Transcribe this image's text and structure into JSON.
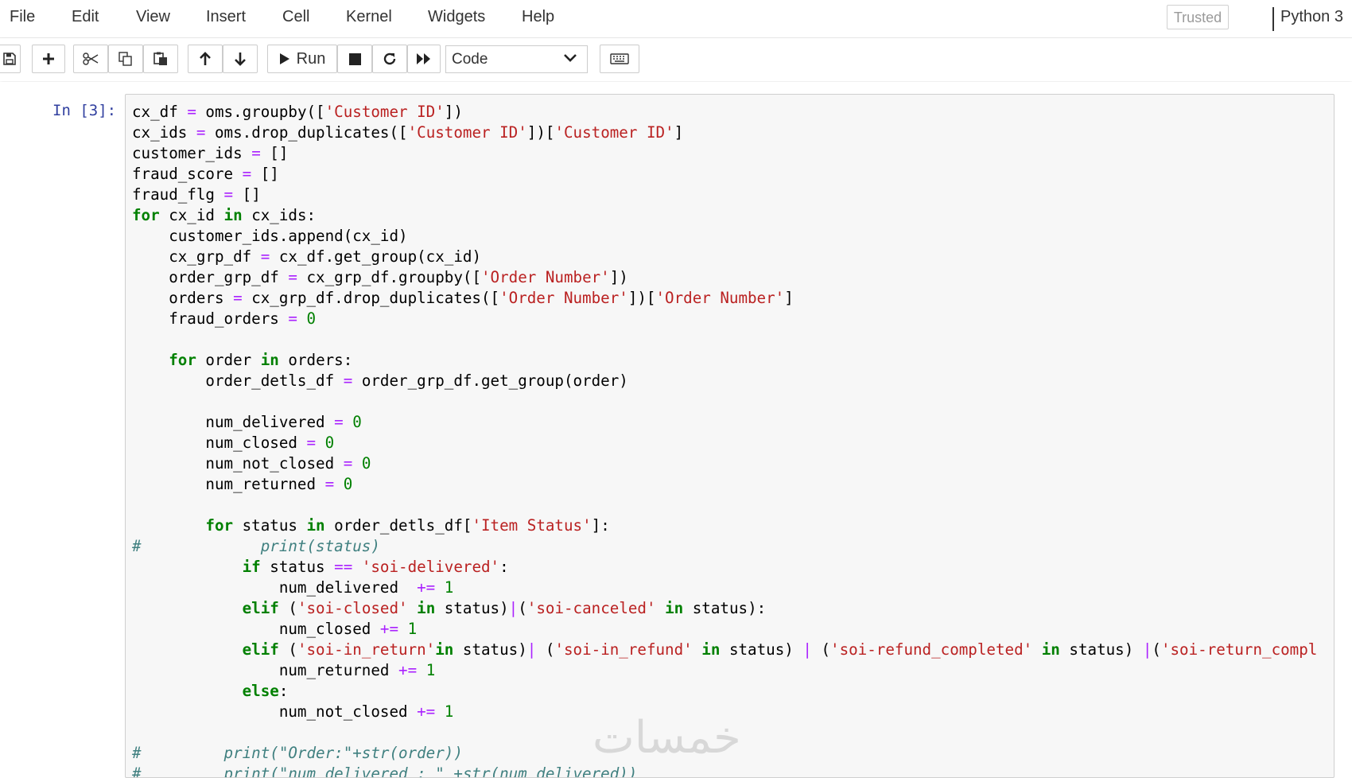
{
  "menu": {
    "items": [
      "File",
      "Edit",
      "View",
      "Insert",
      "Cell",
      "Kernel",
      "Widgets",
      "Help"
    ],
    "trusted_label": "Trusted",
    "kernel_name": "Python 3"
  },
  "toolbar": {
    "run_label": "Run",
    "cell_type": "Code",
    "buttons": [
      "save-icon",
      "plus-icon",
      "scissors-icon",
      "copy-icon",
      "paste-icon",
      "arrow-up-icon",
      "arrow-down-icon",
      "play-icon",
      "stop-icon",
      "restart-icon",
      "fast-forward-icon",
      "keyboard-icon"
    ]
  },
  "cell": {
    "prompt": "In [3]:",
    "lines": [
      [
        [
          "t",
          "cx_df "
        ],
        [
          "o",
          "="
        ],
        [
          "t",
          " oms.groupby(["
        ],
        [
          "s",
          "'Customer ID'"
        ],
        [
          "t",
          "])"
        ]
      ],
      [
        [
          "t",
          "cx_ids "
        ],
        [
          "o",
          "="
        ],
        [
          "t",
          " oms.drop_duplicates(["
        ],
        [
          "s",
          "'Customer ID'"
        ],
        [
          "t",
          "])["
        ],
        [
          "s",
          "'Customer ID'"
        ],
        [
          "t",
          "]"
        ]
      ],
      [
        [
          "t",
          "customer_ids "
        ],
        [
          "o",
          "="
        ],
        [
          "t",
          " []"
        ]
      ],
      [
        [
          "t",
          "fraud_score "
        ],
        [
          "o",
          "="
        ],
        [
          "t",
          " []"
        ]
      ],
      [
        [
          "t",
          "fraud_flg "
        ],
        [
          "o",
          "="
        ],
        [
          "t",
          " []"
        ]
      ],
      [
        [
          "k",
          "for"
        ],
        [
          "t",
          " cx_id "
        ],
        [
          "k",
          "in"
        ],
        [
          "t",
          " cx_ids:"
        ]
      ],
      [
        [
          "t",
          "    customer_ids.append(cx_id)"
        ]
      ],
      [
        [
          "t",
          "    cx_grp_df "
        ],
        [
          "o",
          "="
        ],
        [
          "t",
          " cx_df.get_group(cx_id)"
        ]
      ],
      [
        [
          "t",
          "    order_grp_df "
        ],
        [
          "o",
          "="
        ],
        [
          "t",
          " cx_grp_df.groupby(["
        ],
        [
          "s",
          "'Order Number'"
        ],
        [
          "t",
          "])"
        ]
      ],
      [
        [
          "t",
          "    orders "
        ],
        [
          "o",
          "="
        ],
        [
          "t",
          " cx_grp_df.drop_duplicates(["
        ],
        [
          "s",
          "'Order Number'"
        ],
        [
          "t",
          "])["
        ],
        [
          "s",
          "'Order Number'"
        ],
        [
          "t",
          "]"
        ]
      ],
      [
        [
          "t",
          "    fraud_orders "
        ],
        [
          "o",
          "="
        ],
        [
          "t",
          " "
        ],
        [
          "n",
          "0"
        ]
      ],
      [
        [
          "t",
          ""
        ]
      ],
      [
        [
          "t",
          "    "
        ],
        [
          "k",
          "for"
        ],
        [
          "t",
          " order "
        ],
        [
          "k",
          "in"
        ],
        [
          "t",
          " orders:"
        ]
      ],
      [
        [
          "t",
          "        order_detls_df "
        ],
        [
          "o",
          "="
        ],
        [
          "t",
          " order_grp_df.get_group(order)"
        ]
      ],
      [
        [
          "t",
          ""
        ]
      ],
      [
        [
          "t",
          "        num_delivered "
        ],
        [
          "o",
          "="
        ],
        [
          "t",
          " "
        ],
        [
          "n",
          "0"
        ]
      ],
      [
        [
          "t",
          "        num_closed "
        ],
        [
          "o",
          "="
        ],
        [
          "t",
          " "
        ],
        [
          "n",
          "0"
        ]
      ],
      [
        [
          "t",
          "        num_not_closed "
        ],
        [
          "o",
          "="
        ],
        [
          "t",
          " "
        ],
        [
          "n",
          "0"
        ]
      ],
      [
        [
          "t",
          "        num_returned "
        ],
        [
          "o",
          "="
        ],
        [
          "t",
          " "
        ],
        [
          "n",
          "0"
        ]
      ],
      [
        [
          "t",
          ""
        ]
      ],
      [
        [
          "t",
          "        "
        ],
        [
          "k",
          "for"
        ],
        [
          "t",
          " status "
        ],
        [
          "k",
          "in"
        ],
        [
          "t",
          " order_detls_df["
        ],
        [
          "s",
          "'Item Status'"
        ],
        [
          "t",
          "]:"
        ]
      ],
      [
        [
          "c",
          "#             print(status)"
        ]
      ],
      [
        [
          "t",
          "            "
        ],
        [
          "k",
          "if"
        ],
        [
          "t",
          " status "
        ],
        [
          "o",
          "=="
        ],
        [
          "t",
          " "
        ],
        [
          "s",
          "'soi-delivered'"
        ],
        [
          "t",
          ":"
        ]
      ],
      [
        [
          "t",
          "                num_delivered  "
        ],
        [
          "o",
          "+="
        ],
        [
          "t",
          " "
        ],
        [
          "n",
          "1"
        ]
      ],
      [
        [
          "t",
          "            "
        ],
        [
          "k",
          "elif"
        ],
        [
          "t",
          " ("
        ],
        [
          "s",
          "'soi-closed'"
        ],
        [
          "t",
          " "
        ],
        [
          "k",
          "in"
        ],
        [
          "t",
          " status)"
        ],
        [
          "o",
          "|"
        ],
        [
          "t",
          "("
        ],
        [
          "s",
          "'soi-canceled'"
        ],
        [
          "t",
          " "
        ],
        [
          "k",
          "in"
        ],
        [
          "t",
          " status):"
        ]
      ],
      [
        [
          "t",
          "                num_closed "
        ],
        [
          "o",
          "+="
        ],
        [
          "t",
          " "
        ],
        [
          "n",
          "1"
        ]
      ],
      [
        [
          "t",
          "            "
        ],
        [
          "k",
          "elif"
        ],
        [
          "t",
          " ("
        ],
        [
          "s",
          "'soi-in_return'"
        ],
        [
          "k",
          "in"
        ],
        [
          "t",
          " status)"
        ],
        [
          "o",
          "|"
        ],
        [
          "t",
          " ("
        ],
        [
          "s",
          "'soi-in_refund'"
        ],
        [
          "t",
          " "
        ],
        [
          "k",
          "in"
        ],
        [
          "t",
          " status) "
        ],
        [
          "o",
          "|"
        ],
        [
          "t",
          " ("
        ],
        [
          "s",
          "'soi-refund_completed'"
        ],
        [
          "t",
          " "
        ],
        [
          "k",
          "in"
        ],
        [
          "t",
          " status) "
        ],
        [
          "o",
          "|"
        ],
        [
          "t",
          "("
        ],
        [
          "s",
          "'soi-return_compl"
        ]
      ],
      [
        [
          "t",
          "                num_returned "
        ],
        [
          "o",
          "+="
        ],
        [
          "t",
          " "
        ],
        [
          "n",
          "1"
        ]
      ],
      [
        [
          "t",
          "            "
        ],
        [
          "k",
          "else"
        ],
        [
          "t",
          ":"
        ]
      ],
      [
        [
          "t",
          "                num_not_closed "
        ],
        [
          "o",
          "+="
        ],
        [
          "t",
          " "
        ],
        [
          "n",
          "1"
        ]
      ],
      [
        [
          "t",
          ""
        ]
      ],
      [
        [
          "c",
          "#         print(\"Order:\"+str(order))"
        ]
      ],
      [
        [
          "c",
          "#         print(\"num_delivered : \" +str(num_delivered))"
        ]
      ]
    ]
  },
  "watermark": "خمسات"
}
